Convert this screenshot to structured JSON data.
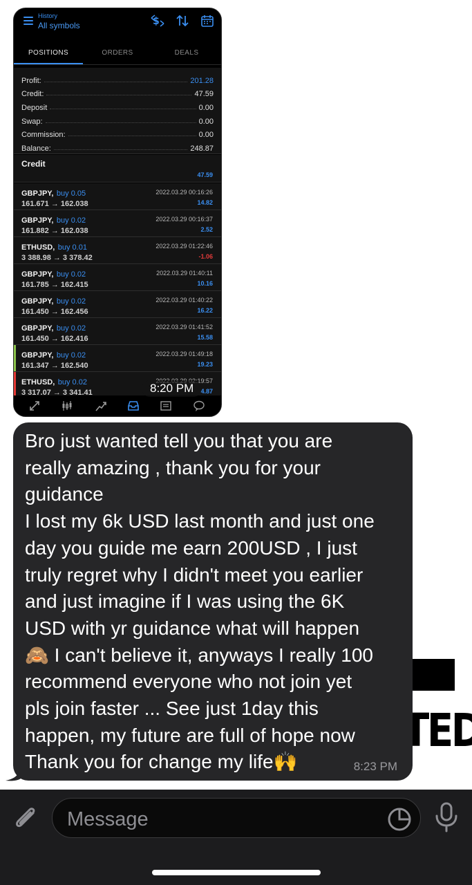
{
  "mt_screen": {
    "header_small": "History",
    "header_title": "All symbols",
    "tabs": [
      "POSITIONS",
      "ORDERS",
      "DEALS"
    ],
    "summary": [
      {
        "label": "Profit:",
        "value": "201.28",
        "highlight": true
      },
      {
        "label": "Credit:",
        "value": "47.59",
        "highlight": false
      },
      {
        "label": "Deposit",
        "value": "0.00",
        "highlight": false
      },
      {
        "label": "Swap:",
        "value": "0.00",
        "highlight": false
      },
      {
        "label": "Commission:",
        "value": "0.00",
        "highlight": false
      },
      {
        "label": "Balance:",
        "value": "248.87",
        "highlight": false
      }
    ],
    "credit_section": {
      "title": "Credit",
      "value": "47.59"
    },
    "deals": [
      {
        "symbol": "GBPJPY,",
        "type": "buy 0.05",
        "prices": "161.671 → 162.038",
        "time": "2022.03.29 00:16:26",
        "profit": "14.82",
        "negative": false,
        "edge": ""
      },
      {
        "symbol": "GBPJPY,",
        "type": "buy 0.02",
        "prices": "161.882 → 162.038",
        "time": "2022.03.29 00:16:37",
        "profit": "2.52",
        "negative": false,
        "edge": ""
      },
      {
        "symbol": "ETHUSD,",
        "type": "buy 0.01",
        "prices": "3 388.98 → 3 378.42",
        "time": "2022.03.29 01:22:46",
        "profit": "-1.06",
        "negative": true,
        "edge": ""
      },
      {
        "symbol": "GBPJPY,",
        "type": "buy 0.02",
        "prices": "161.785 → 162.415",
        "time": "2022.03.29 01:40:11",
        "profit": "10.16",
        "negative": false,
        "edge": ""
      },
      {
        "symbol": "GBPJPY,",
        "type": "buy 0.02",
        "prices": "161.450 → 162.456",
        "time": "2022.03.29 01:40:22",
        "profit": "16.22",
        "negative": false,
        "edge": ""
      },
      {
        "symbol": "GBPJPY,",
        "type": "buy 0.02",
        "prices": "161.450 → 162.416",
        "time": "2022.03.29 01:41:52",
        "profit": "15.58",
        "negative": false,
        "edge": ""
      },
      {
        "symbol": "GBPJPY,",
        "type": "buy 0.02",
        "prices": "161.347 → 162.540",
        "time": "2022.03.29 01:49:18",
        "profit": "19.23",
        "negative": false,
        "edge": "#8bc34a"
      },
      {
        "symbol": "ETHUSD,",
        "type": "buy 0.02",
        "prices": "3 317.07 → 3 341.41",
        "time": "2022.03.29 02:19:57",
        "profit": "4.87",
        "negative": false,
        "edge": "#e53935"
      }
    ],
    "bottom_icons": [
      "quotes-icon",
      "chart-icon",
      "trade-icon",
      "history-icon",
      "news-icon",
      "messages-icon"
    ]
  },
  "image_message_time": "8:20 PM",
  "text_message": {
    "text": "Bro just wanted tell you that you are\nreally amazing , thank you for your\nguidance\nI lost my 6k USD last month and just one\nday you guide me earn 200USD , I just\ntruly regret why I didn't meet you earlier\nand just imagine if I was using the 6K\nUSD with yr guidance what will happen\n🙈 I can't believe it, anyways I really 100\nrecommend everyone who not join yet\npls join faster ... See just 1day this\nhappen, my future are full of hope now\nThank you for change my life🙌",
    "time": "8:23 PM"
  },
  "background_text": "TED",
  "input": {
    "placeholder": "Message"
  },
  "colors": {
    "accent": "#3a8ef0",
    "negative": "#e03a3a",
    "bubble": "#262628"
  }
}
